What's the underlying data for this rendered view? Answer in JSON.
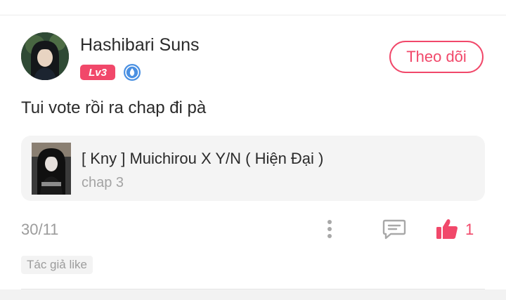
{
  "post": {
    "username": "Hashibari Suns",
    "level_badge": "Lv3",
    "follow_label": "Theo dõi",
    "comment": "Tui vote rồi ra chap đi pà",
    "date": "30/11",
    "like_count": "1",
    "author_like_tag": "Tác giả like"
  },
  "story": {
    "title": "[ Kny ] Muichirou X Y/N ( Hiện Đại )",
    "chapter": "chap 3"
  },
  "icons": {
    "verify": "verified-badge-icon",
    "more": "more-vertical-icon",
    "comment": "comment-icon",
    "like": "thumbs-up-icon"
  },
  "colors": {
    "accent": "#f1486a",
    "verify_blue": "#4a90e2",
    "muted_text": "#9c9c9c",
    "card_background": "#f4f4f4"
  }
}
